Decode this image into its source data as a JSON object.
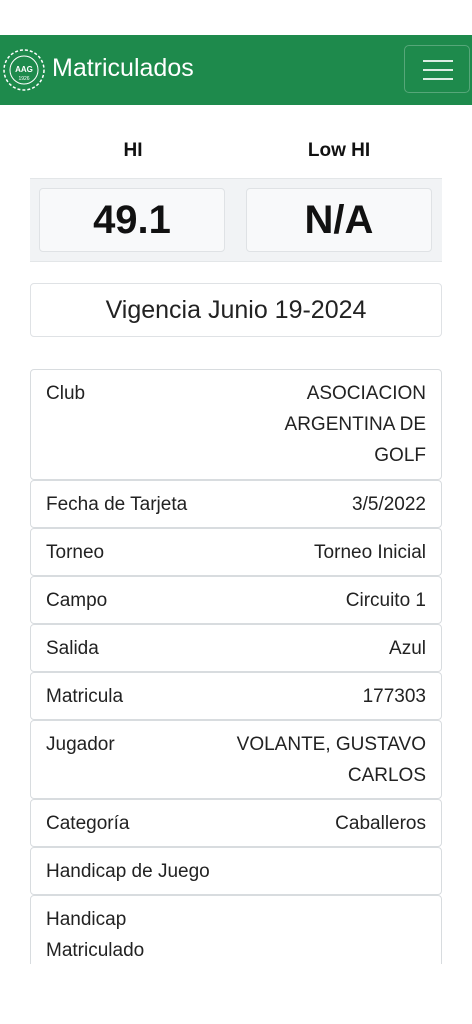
{
  "navbar": {
    "title": "Matriculados",
    "logo_text": "AAG",
    "logo_year": "1926",
    "brand_color": "#1e8a4c",
    "menu_icon": "hamburger-menu-icon"
  },
  "handicap": {
    "hi_label": "HI",
    "low_hi_label": "Low HI",
    "hi_value": "49.1",
    "low_hi_value": "N/A"
  },
  "vigencia": "Vigencia Junio 19-2024",
  "details": [
    {
      "label": "Club",
      "value_lines": [
        "ASOCIACION",
        "ARGENTINA DE",
        "GOLF"
      ]
    },
    {
      "label": "Fecha de Tarjeta",
      "value": "3/5/2022"
    },
    {
      "label": "Torneo",
      "value": "Torneo Inicial"
    },
    {
      "label": "Campo",
      "value": "Circuito 1"
    },
    {
      "label": "Salida",
      "value": "Azul"
    },
    {
      "label": "Matricula",
      "value": "177303"
    },
    {
      "label": "Jugador",
      "value_lines": [
        "VOLANTE, GUSTAVO",
        "CARLOS"
      ]
    },
    {
      "label": "Categoría",
      "value": "Caballeros"
    },
    {
      "label": "Handicap de Juego",
      "value": ""
    },
    {
      "label_lines": [
        "Handicap",
        "Matriculado"
      ],
      "value": ""
    }
  ]
}
